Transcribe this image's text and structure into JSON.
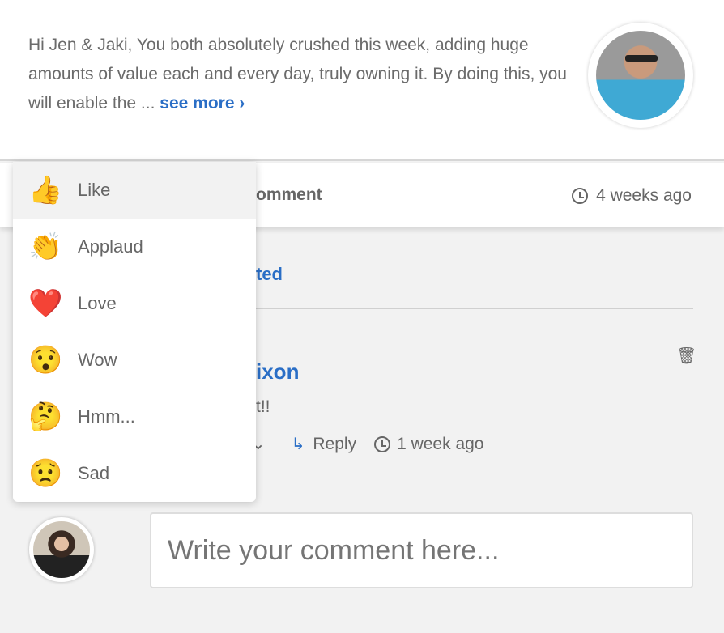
{
  "post": {
    "message": "Hi Jen & Jaki, You both absolutely crushed this week, adding huge amounts of value each and every day, truly owning it. By doing this, you will enable the ...",
    "see_more": "see more ›"
  },
  "action_bar": {
    "comment_label": "omment",
    "time": "4 weeks ago"
  },
  "section": {
    "partial_heading": "ted"
  },
  "comment": {
    "author_partial": "ixon",
    "body_partial": "t!!",
    "reply": "Reply",
    "time": "1 week ago"
  },
  "composer": {
    "placeholder": "Write your comment here..."
  },
  "reactions": [
    {
      "emoji": "👍",
      "label": "Like"
    },
    {
      "emoji": "👏",
      "label": "Applaud"
    },
    {
      "emoji": "❤️",
      "label": "Love"
    },
    {
      "emoji": "😯",
      "label": "Wow"
    },
    {
      "emoji": "🤔",
      "label": "Hmm..."
    },
    {
      "emoji": "😟",
      "label": "Sad"
    }
  ],
  "colors": {
    "accent": "#2a6ec6",
    "background": "#f2f2f2"
  }
}
